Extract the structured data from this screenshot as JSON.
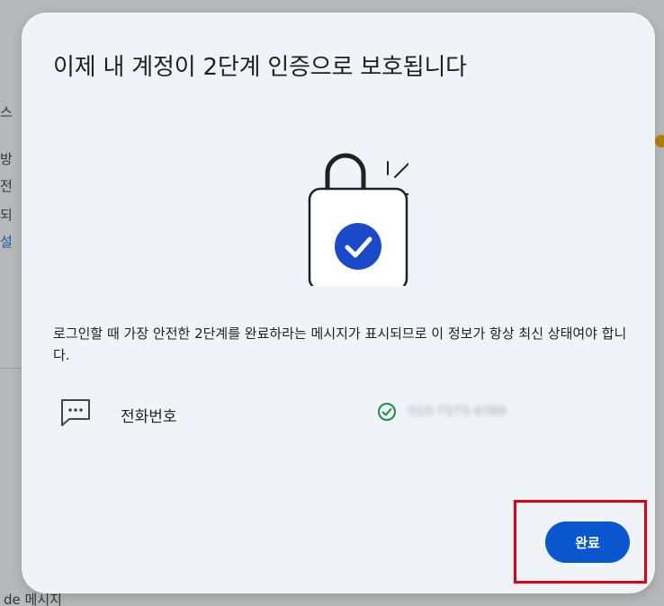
{
  "background": {
    "fragments": [
      "스",
      "방",
      "전",
      "되",
      "설"
    ],
    "bottom_text": "de 메시지"
  },
  "dialog": {
    "title": "이제 내 계정이 2단계 인증으로 보호됩니다",
    "description": "로그인할 때 가장 안전한 2단계를 완료하라는 메시지가 표시되므로 이 정보가 항상 최신 상태여야 합니다.",
    "method": {
      "label": "전화번호",
      "icon": "sms-icon",
      "status_icon": "check-circle-icon",
      "value": "010-7573-4789"
    },
    "done_label": "완료"
  },
  "colors": {
    "accent": "#0b57d0",
    "success": "#1e8e3e",
    "highlight": "#e0000f",
    "dialog_bg": "#f0f4f9"
  }
}
